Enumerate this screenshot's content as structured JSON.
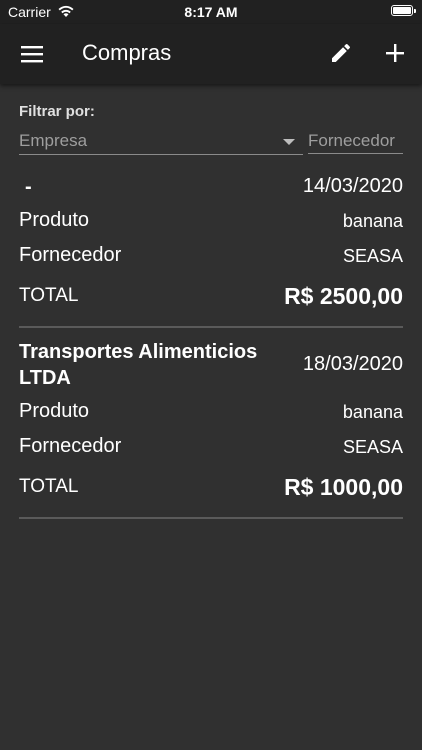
{
  "status_bar": {
    "carrier": "Carrier",
    "time": "8:17 AM"
  },
  "app_bar": {
    "title": "Compras",
    "menu_icon": "menu-icon",
    "edit_icon": "pencil-icon",
    "add_icon": "plus-icon"
  },
  "filter": {
    "label": "Filtrar por:",
    "empresa_placeholder": "Empresa",
    "fornecedor_placeholder": "Fornecedor"
  },
  "purchases": [
    {
      "company": "-",
      "date": "14/03/2020",
      "product_label": "Produto",
      "product": "banana",
      "supplier_label": "Fornecedor",
      "supplier": "SEASA",
      "total_label": "TOTAL",
      "total": "R$ 2500,00"
    },
    {
      "company": "Transportes Alimenticios LTDA",
      "date": "18/03/2020",
      "product_label": "Produto",
      "product": "banana",
      "supplier_label": "Fornecedor",
      "supplier": "SEASA",
      "total_label": "TOTAL",
      "total": "R$ 1000,00"
    }
  ],
  "colors": {
    "background": "#303030",
    "app_bar": "#212121",
    "divider": "#5a5a5a",
    "placeholder": "#9e9e9e"
  }
}
